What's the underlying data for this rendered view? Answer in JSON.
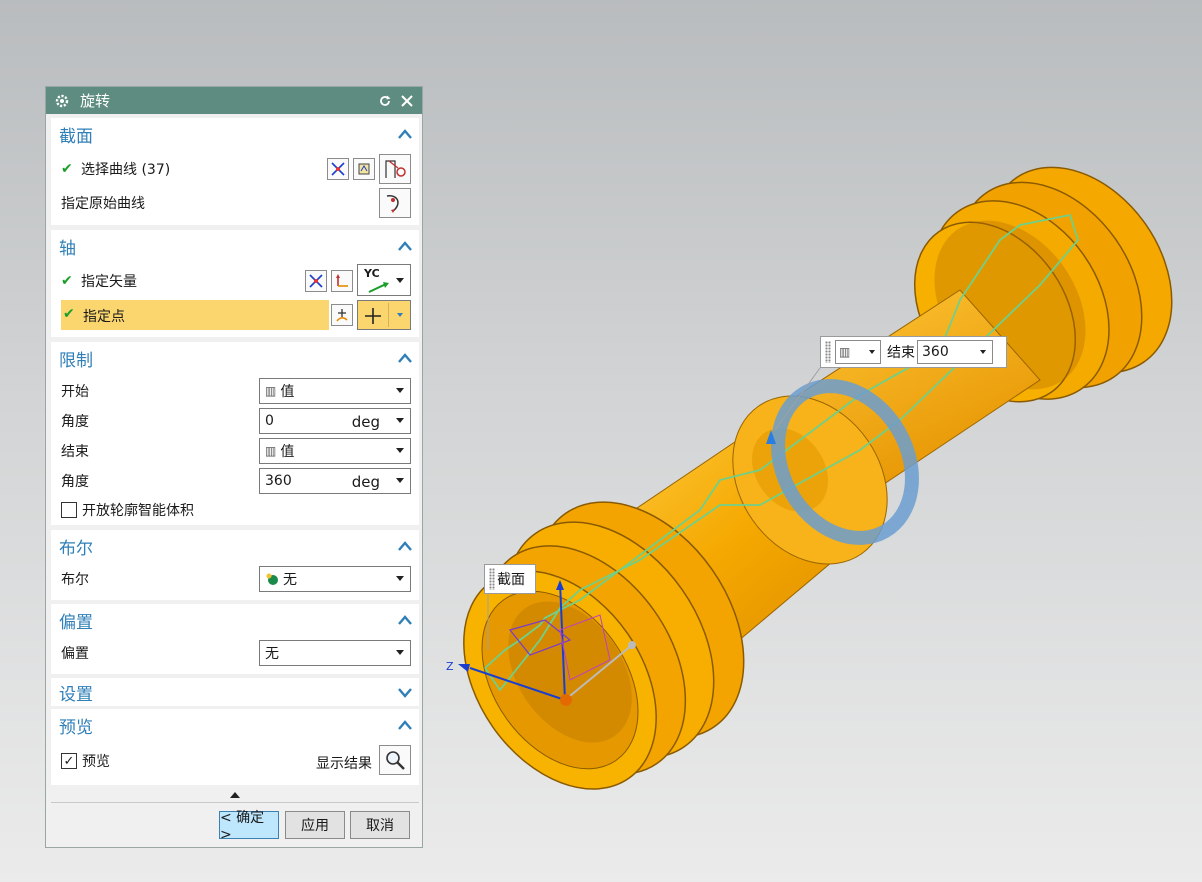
{
  "dialog": {
    "title": "旋转",
    "sections": {
      "section": {
        "title": "截面",
        "select_curve": "选择曲线 (37)",
        "specify_origin_curve": "指定原始曲线"
      },
      "axis": {
        "title": "轴",
        "specify_vector": "指定矢量",
        "vector_option": "YC",
        "specify_point": "指定点"
      },
      "limits": {
        "title": "限制",
        "start_label": "开始",
        "start_value": "值",
        "start_angle_label": "角度",
        "start_angle_value": "0",
        "start_angle_unit": "deg",
        "end_label": "结束",
        "end_value": "值",
        "end_angle_label": "角度",
        "end_angle_value": "360",
        "end_angle_unit": "deg",
        "open_profile_label": "开放轮廓智能体积",
        "open_profile_checked": false
      },
      "boolean": {
        "title": "布尔",
        "label": "布尔",
        "value": "无"
      },
      "offset": {
        "title": "偏置",
        "label": "偏置",
        "value": "无"
      },
      "settings": {
        "title": "设置"
      },
      "preview": {
        "title": "预览",
        "checkbox_label": "预览",
        "checked": true,
        "show_result_label": "显示结果"
      }
    },
    "buttons": {
      "ok": "< 确定 >",
      "apply": "应用",
      "cancel": "取消"
    }
  },
  "viewport": {
    "end_label": "结束",
    "end_value": "360",
    "section_label": "截面",
    "axis_z_label": "Z"
  },
  "colors": {
    "titlebar": "#5f8c80",
    "section_title": "#2f7fb8",
    "highlight": "#fbd66e",
    "part_orange": "#f5a800",
    "ok_button": "#bee6fd"
  }
}
